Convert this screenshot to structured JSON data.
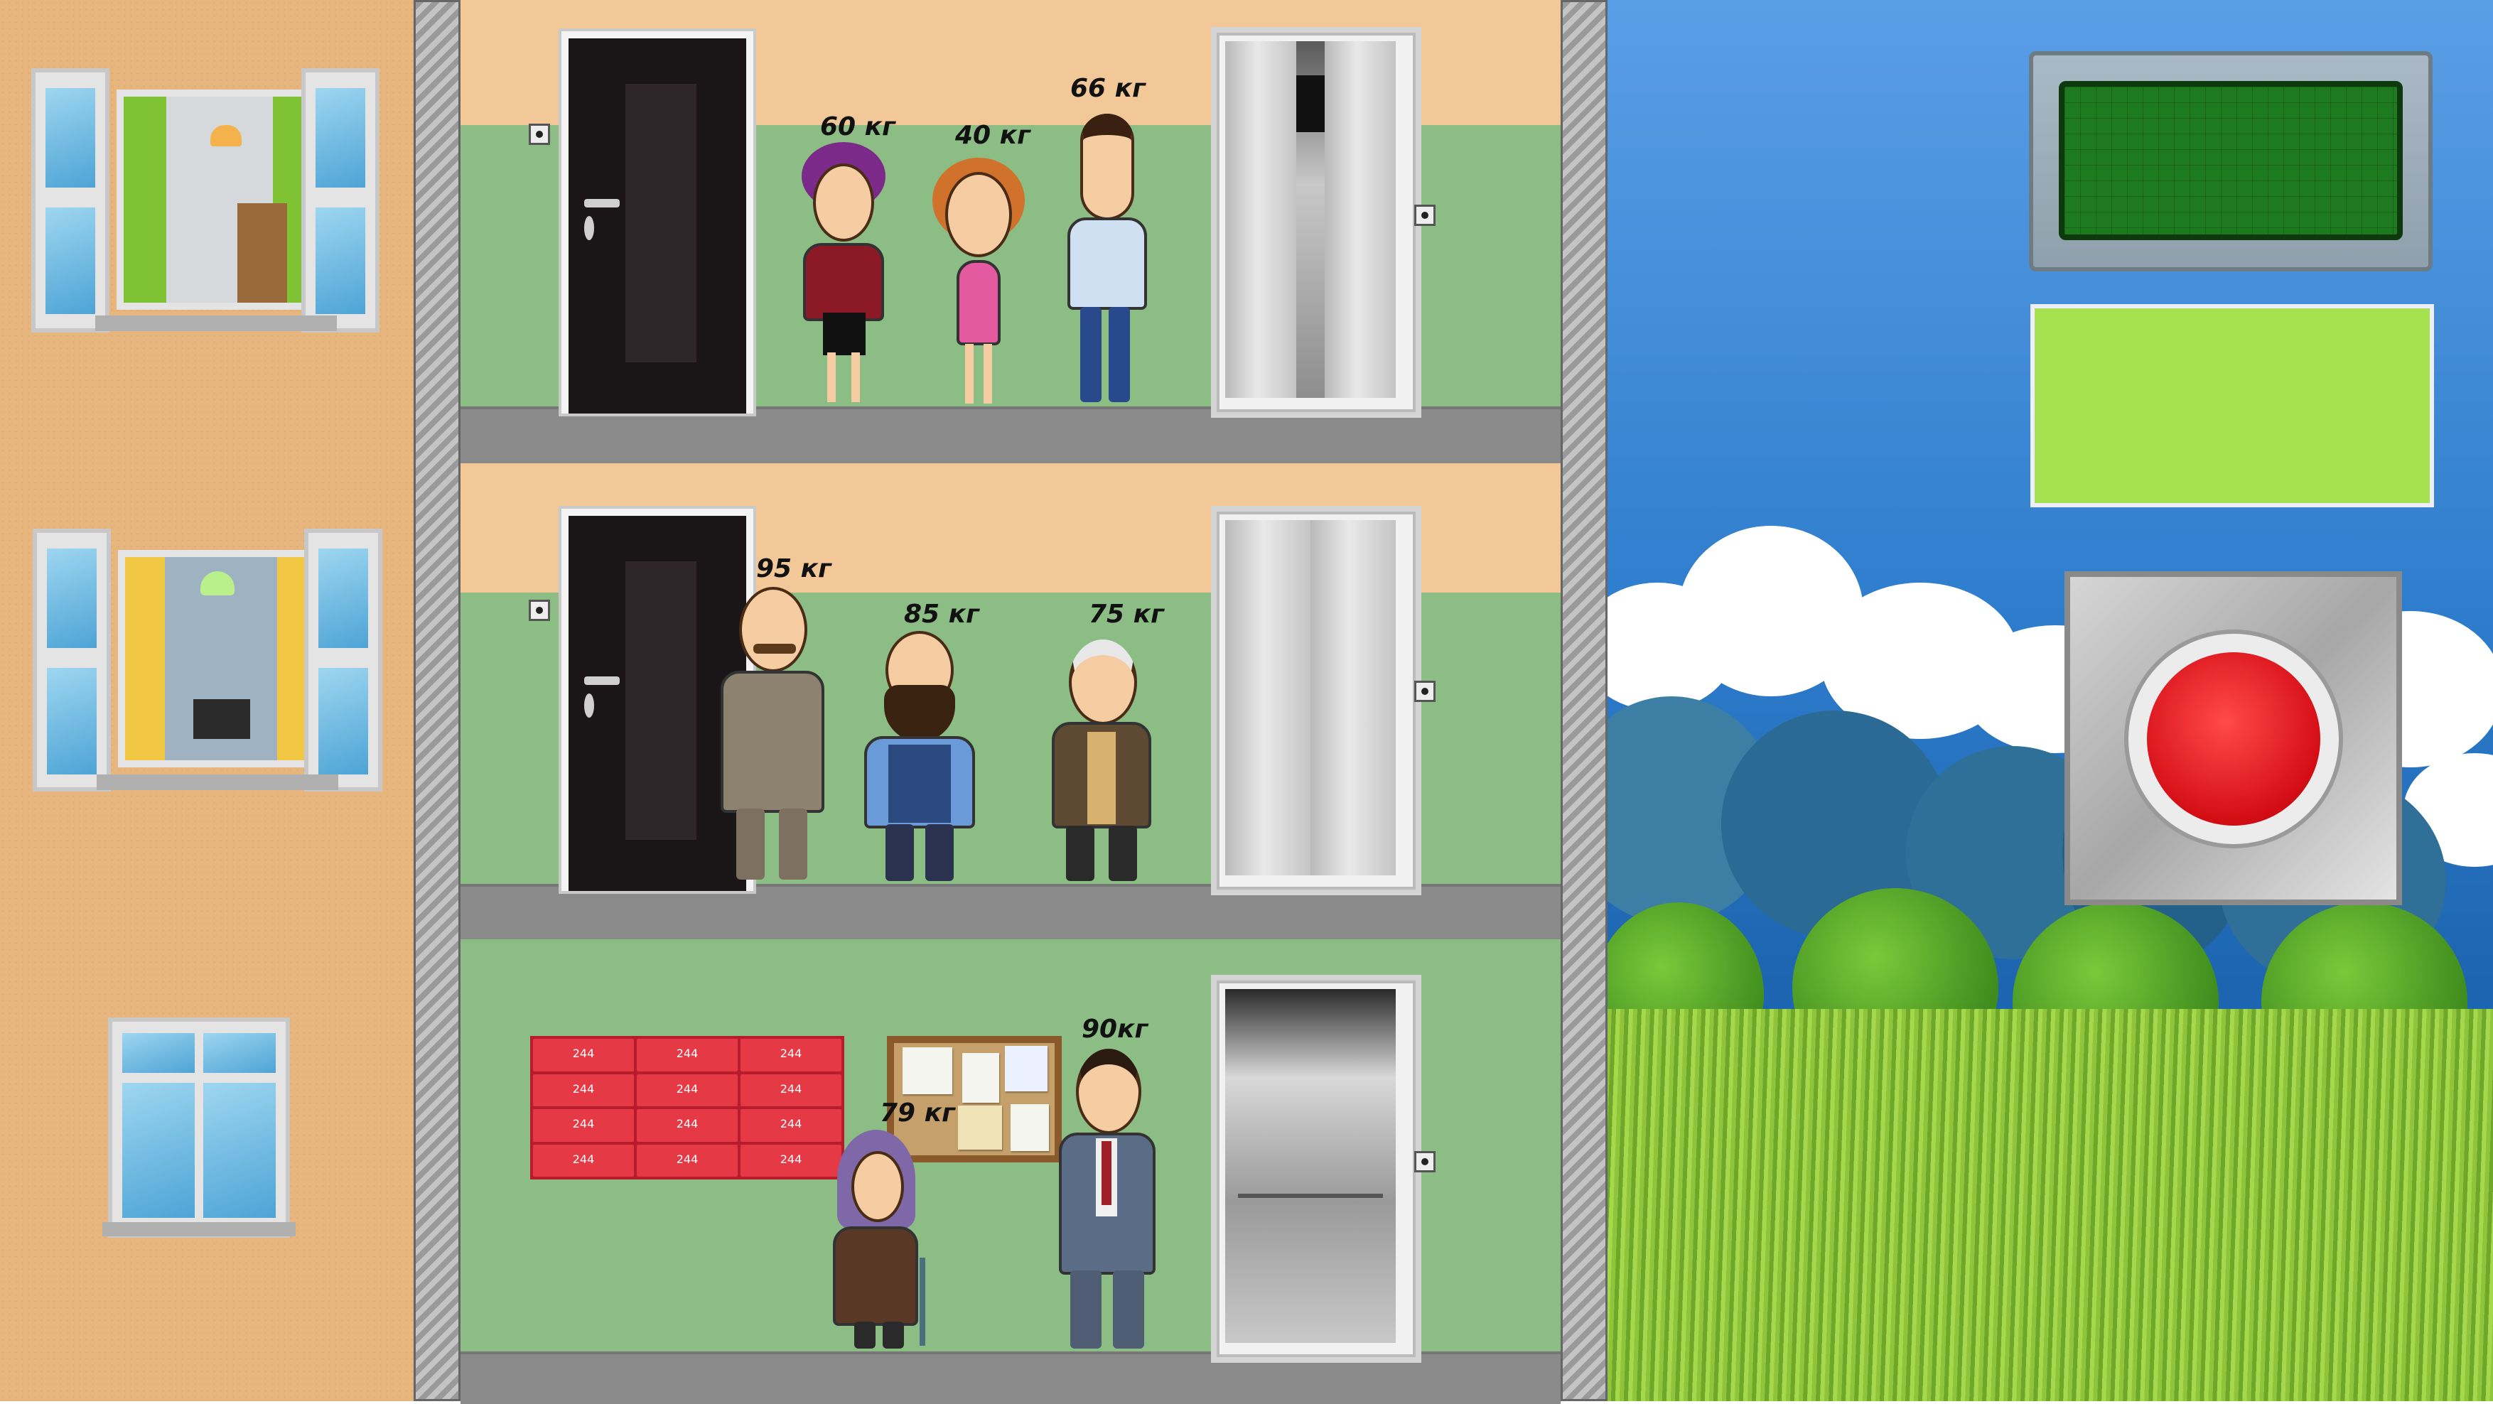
{
  "floors": [
    {
      "name": "top",
      "people": [
        {
          "weight_label": "60 кг",
          "role": "woman-glasses"
        },
        {
          "weight_label": "40 кг",
          "role": "girl-pink-dress"
        },
        {
          "weight_label": "66 кг",
          "role": "young-man"
        }
      ]
    },
    {
      "name": "middle",
      "people": [
        {
          "weight_label": "95 кг",
          "role": "man-mustache-suit"
        },
        {
          "weight_label": "85 кг",
          "role": "bearded-man"
        },
        {
          "weight_label": "75 кг",
          "role": "old-man"
        }
      ]
    },
    {
      "name": "ground",
      "people": [
        {
          "weight_label": "79 кг",
          "role": "old-woman-cane"
        },
        {
          "weight_label": "90кг",
          "role": "man-glasses-suit"
        }
      ]
    }
  ],
  "mailbox_label": "244",
  "colors": {
    "wall_green": "#8cbd85",
    "wall_beige": "#f3c898",
    "display_green": "#1e7a1e",
    "panel_green": "#a6e24f",
    "button_red": "#d40d14"
  },
  "icons": [
    "door-icon",
    "elevator-icon",
    "call-button-icon",
    "mailbox-icon",
    "notice-board-icon",
    "red-button-icon"
  ]
}
